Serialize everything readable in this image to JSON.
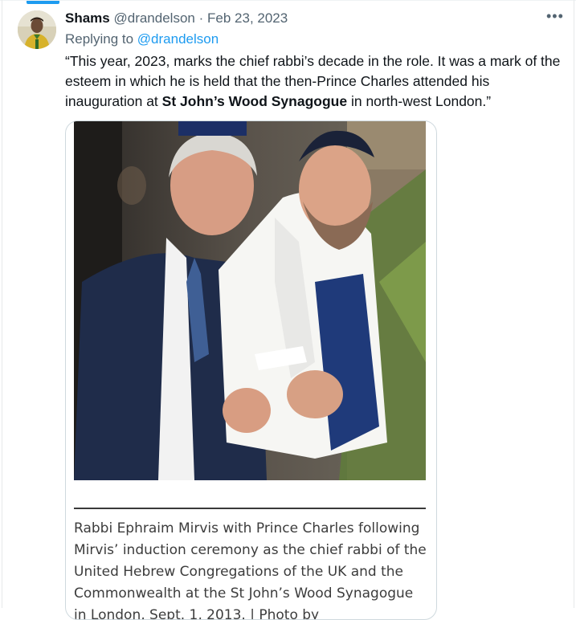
{
  "tweet": {
    "author_name": "Shams",
    "author_handle": "@drandelson",
    "separator": "·",
    "date": "Feb 23, 2023",
    "more_label": "•••",
    "replying_prefix": "Replying to",
    "replying_to": "@drandelson",
    "text_part1": "“This year, 2023, marks the chief rabbi’s decade in the role. It was a mark of the esteem in which he is held that the then-Prince Charles attended his inauguration at ",
    "text_bold": "St John’s Wood Synagogue",
    "text_part2": " in north-west London.”"
  },
  "media": {
    "image_description": "Photo of Rabbi Ephraim Mirvis in a white tallit and Prince Charles in a navy suit",
    "caption": "Rabbi Ephraim Mirvis with Prince Charles following Mirvis’ induction ceremony as the chief rabbi of the United Hebrew Congregations of the UK and the Commonwealth at the St John’s Wood Synagogue in London, Sept. 1, 2013. | Photo by"
  },
  "colors": {
    "accent": "#1d9bf0",
    "muted_text": "#536471",
    "border": "#cfd9de"
  }
}
